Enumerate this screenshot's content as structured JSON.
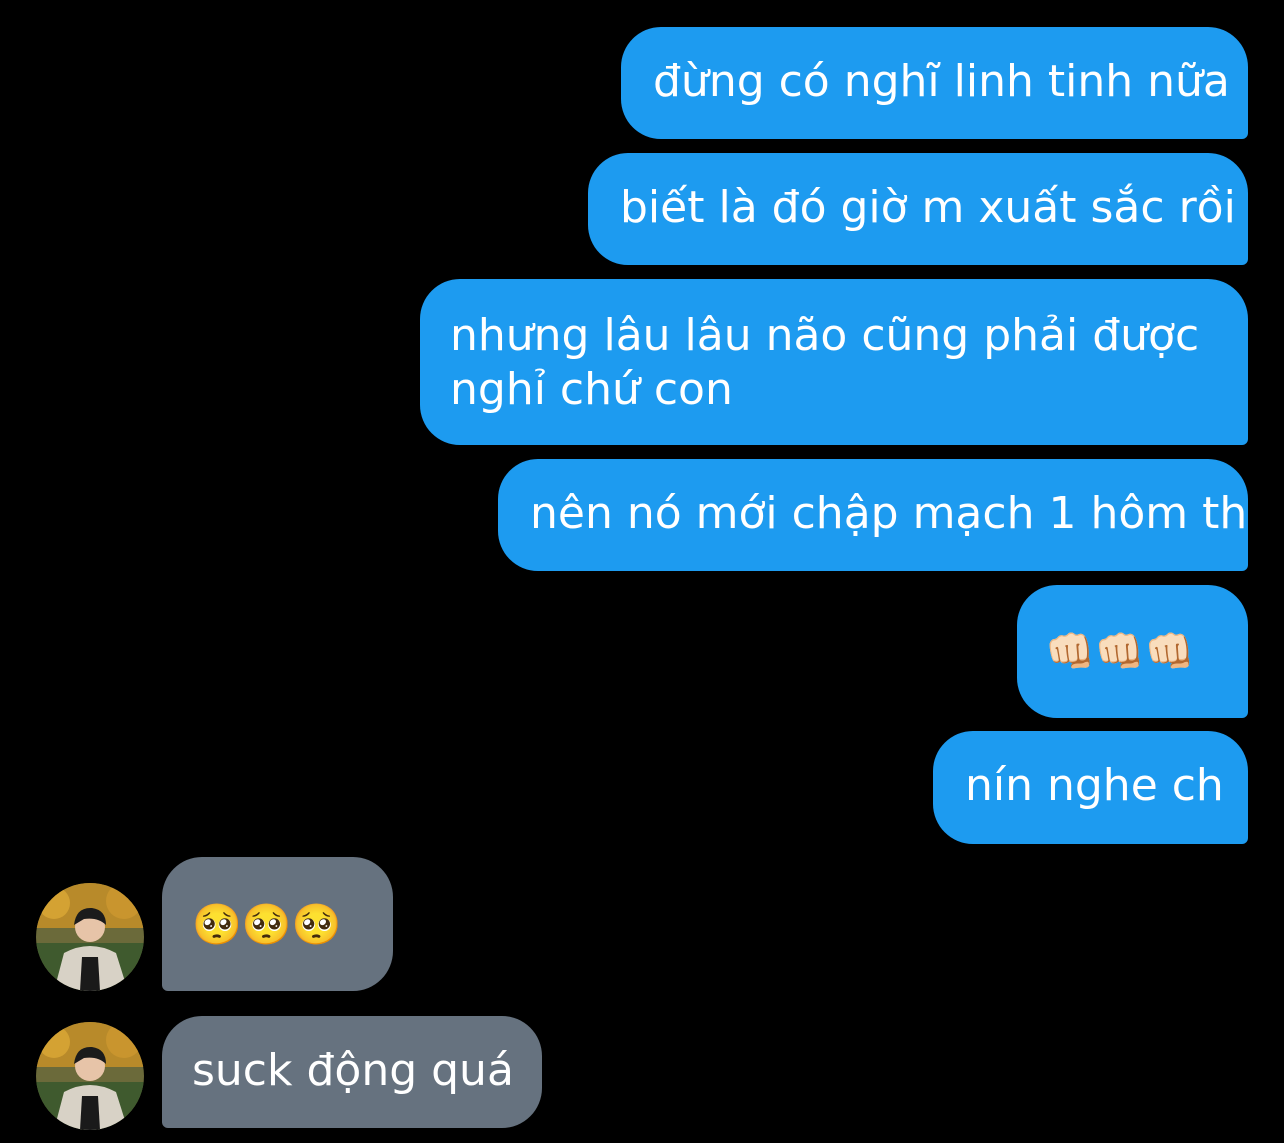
{
  "chat": {
    "outgoing": [
      "đừng có nghĩ linh tinh nữa",
      "biết là đó giờ m xuất sắc rồi",
      "nhưng lâu lâu não cũng phải được nghỉ chứ con",
      "nên nó mới chập mạch 1 hôm th",
      "👊🏻👊🏻👊🏻",
      "nín nghe ch"
    ],
    "incoming": [
      "🥺🥺🥺",
      "suck động quá"
    ]
  },
  "colors": {
    "outgoing_bubble": "#1d9bf0",
    "incoming_bubble": "#66727f",
    "background": "#000000"
  }
}
